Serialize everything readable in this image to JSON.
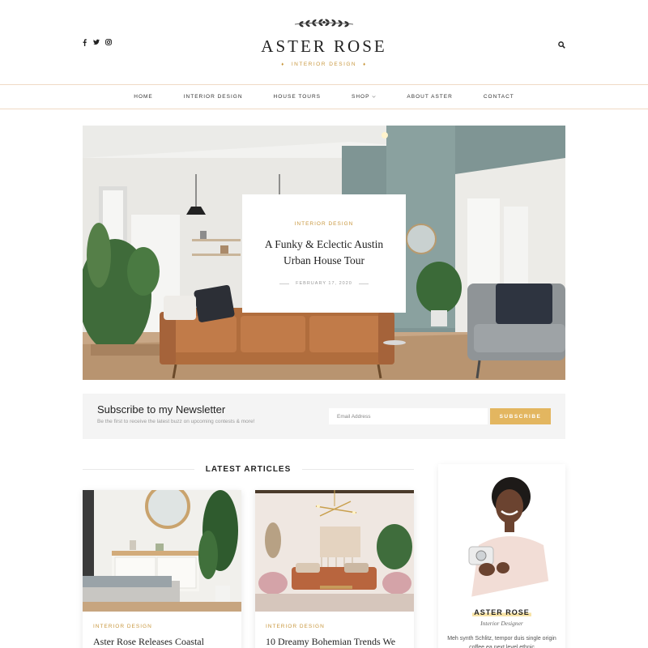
{
  "brand": {
    "name": "ASTER ROSE",
    "tagline": "INTERIOR DESIGN",
    "accent_color": "#c8973e",
    "button_color": "#e3b660"
  },
  "header": {
    "social_icons": [
      "facebook-icon",
      "twitter-icon",
      "instagram-icon"
    ],
    "search_icon": "search-icon"
  },
  "nav": {
    "items": [
      {
        "label": "HOME"
      },
      {
        "label": "INTERIOR DESIGN"
      },
      {
        "label": "HOUSE TOURS"
      },
      {
        "label": "SHOP",
        "has_dropdown": true
      },
      {
        "label": "ABOUT ASTER"
      },
      {
        "label": "CONTACT"
      }
    ]
  },
  "hero": {
    "category": "INTERIOR DESIGN",
    "title": "A Funky & Eclectic Austin Urban House Tour",
    "date": "FEBRUARY 17, 2020"
  },
  "newsletter": {
    "title": "Subscribe to my Newsletter",
    "subtitle": "Be the first to receive the latest buzz on upcoming contests & more!",
    "placeholder": "Email Address",
    "button": "SUBSCRIBE"
  },
  "latest": {
    "heading": "LATEST ARTICLES",
    "articles": [
      {
        "category": "INTERIOR DESIGN",
        "title": "Aster Rose Releases Coastal"
      },
      {
        "category": "INTERIOR DESIGN",
        "title": "10 Dreamy Bohemian Trends We"
      }
    ]
  },
  "sidebar": {
    "name": "ASTER ROSE",
    "role": "Interior Designer",
    "bio": "Meh synth Schlitz, tempor duis single origin coffee ea next level ethnic"
  }
}
